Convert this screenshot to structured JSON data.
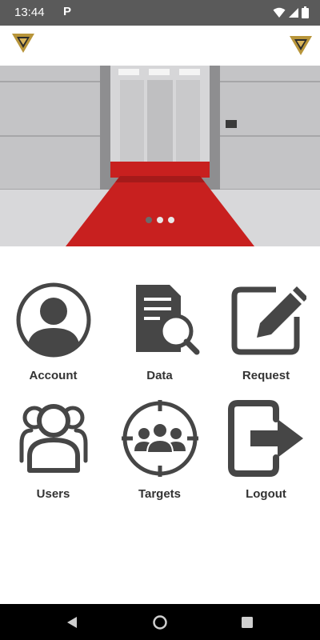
{
  "status_bar": {
    "time": "13:44",
    "notification_letter": "P",
    "icons": [
      "wifi-icon",
      "signal-icon",
      "battery-icon"
    ]
  },
  "app_bar": {
    "left_logo": "brand-logo",
    "right_logo": "brand-logo",
    "logo_colors": {
      "gold": "#b8953a",
      "dark": "#2b2b2b"
    }
  },
  "hero": {
    "image": "elevator-with-red-carpet",
    "slides": 3,
    "active_slide": 1
  },
  "menu": [
    {
      "label": "Account",
      "icon": "account-icon"
    },
    {
      "label": "Data",
      "icon": "data-search-icon"
    },
    {
      "label": "Request",
      "icon": "edit-request-icon"
    },
    {
      "label": "Users",
      "icon": "users-icon"
    },
    {
      "label": "Targets",
      "icon": "targets-icon"
    },
    {
      "label": "Logout",
      "icon": "logout-icon"
    }
  ],
  "colors": {
    "icon": "#464646",
    "label": "#333333",
    "status_bar": "#5a5a5a",
    "carpet": "#c8201f"
  },
  "nav_bar": {
    "buttons": [
      "back-icon",
      "home-icon",
      "recents-icon"
    ]
  }
}
